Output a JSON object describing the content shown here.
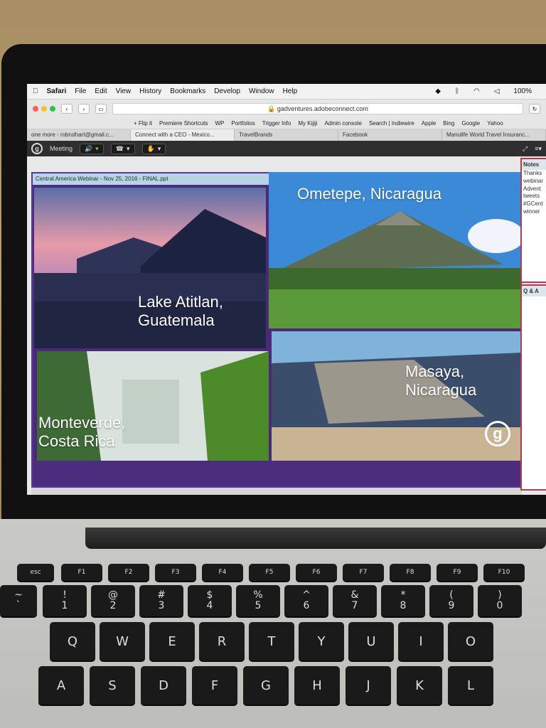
{
  "menubar": {
    "app": "Safari",
    "items": [
      "File",
      "Edit",
      "View",
      "History",
      "Bookmarks",
      "Develop",
      "Window",
      "Help"
    ],
    "battery": "100%"
  },
  "browser": {
    "url": "gadventures.adobeconnect.com",
    "bookmarks": [
      "+ Flip it",
      "Premiere Shortcuts",
      "WP",
      "Portfolios",
      "Trigger Info",
      "My Kijiji",
      "Admin console",
      "Search | Indiewire",
      "Apple",
      "Bing",
      "Google",
      "Yahoo"
    ],
    "tabs": [
      "one more - robruthart@gmail.c...",
      "Connect with a CEO - Mexico...",
      "TravelBrands",
      "Facebook",
      "Manulife World Travel Insuranc..."
    ]
  },
  "connect": {
    "meeting_label": "Meeting",
    "pod_title": "Central America Webinar - Nov 25, 2016 - FINAL.ppt",
    "notes_title": "Notes",
    "notes_lines": [
      "Thanks",
      "webinar",
      "Advent",
      "tweets",
      "#GCent",
      "winner"
    ],
    "qa_title": "Q & A"
  },
  "slide": {
    "tiles": [
      {
        "caption_line1": "Lake Atitlan,",
        "caption_line2": "Guatemala"
      },
      {
        "caption_line1": "Ometepe, Nicaragua",
        "caption_line2": ""
      },
      {
        "caption_line1": "Monteverde,",
        "caption_line2": "Costa Rica"
      },
      {
        "caption_line1": "Masaya,",
        "caption_line2": "Nicaragua"
      }
    ],
    "logo_glyph": "g"
  },
  "keyboard": {
    "fn_row": [
      "esc",
      "F1",
      "F2",
      "F3",
      "F4",
      "F5",
      "F6",
      "F7",
      "F8",
      "F9",
      "F10"
    ],
    "num_row": [
      [
        "~",
        "`"
      ],
      [
        "!",
        "1"
      ],
      [
        "@",
        "2"
      ],
      [
        "#",
        "3"
      ],
      [
        "$",
        "4"
      ],
      [
        "%",
        "5"
      ],
      [
        "^",
        "6"
      ],
      [
        "&",
        "7"
      ],
      [
        "*",
        "8"
      ],
      [
        "(",
        "9"
      ],
      [
        ")",
        "0"
      ]
    ],
    "row_q": [
      "Q",
      "W",
      "E",
      "R",
      "T",
      "Y",
      "U",
      "I",
      "O"
    ],
    "row_a": [
      "A",
      "S",
      "D",
      "F",
      "G",
      "H",
      "J",
      "K",
      "L"
    ]
  },
  "colors": {
    "stage_border": "#5c3795",
    "connect_bar": "#2f2f2f",
    "sidebar_border": "#b43a4c"
  }
}
